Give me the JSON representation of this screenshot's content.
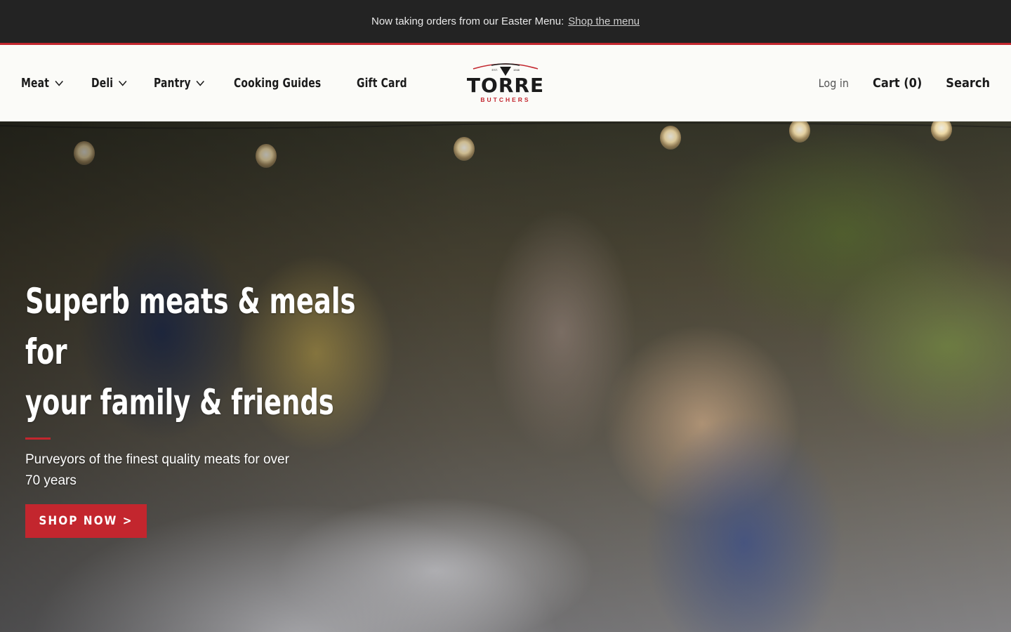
{
  "announcement": {
    "text": "Now taking orders from our Easter Menu:",
    "link": "Shop the menu"
  },
  "nav": {
    "left": [
      {
        "label": "Meat",
        "has_dropdown": true
      },
      {
        "label": "Deli",
        "has_dropdown": true
      },
      {
        "label": "Pantry",
        "has_dropdown": true
      },
      {
        "label": "Cooking Guides",
        "has_dropdown": false
      },
      {
        "label": "Gift Card",
        "has_dropdown": false
      }
    ],
    "right": {
      "login": "Log in",
      "cart": "Cart (0)",
      "search": "Search"
    }
  },
  "logo": {
    "name": "TORRE",
    "tagline": "BUTCHERS",
    "est_left": "EST.",
    "est_right": "1948"
  },
  "hero": {
    "title_line1": "Superb meats & meals for",
    "title_line2": "your family & friends",
    "subtitle": "Purveyors of the finest quality meats for over 70 years",
    "button": "SHOP NOW >"
  },
  "colors": {
    "accent": "#c3262e",
    "announcement_bg": "#232323",
    "header_bg": "#fbfbf8"
  }
}
